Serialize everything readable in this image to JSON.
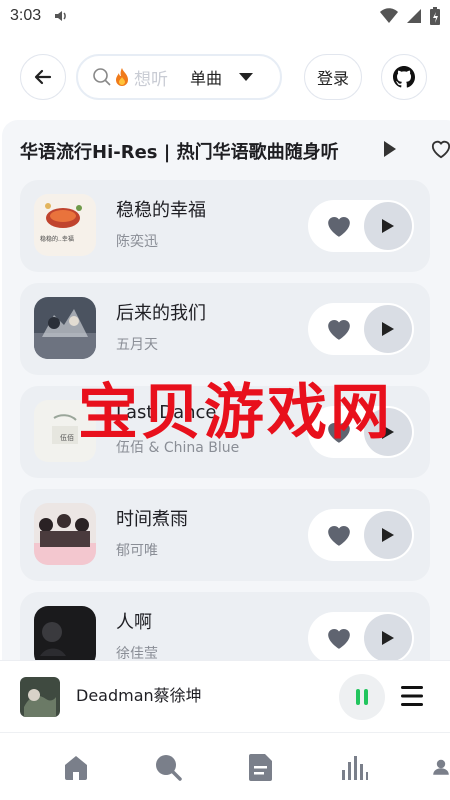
{
  "status_bar": {
    "time": "3:03"
  },
  "search": {
    "placeholder": "想听",
    "selected_type": "单曲"
  },
  "header": {
    "login_label": "登录"
  },
  "playlist": {
    "title": "华语流行Hi-Res | 热门华语歌曲随身听",
    "songs": [
      {
        "title": "稳稳的幸福",
        "artist": "陈奕迅",
        "cover_text": "稳稳的..幸福"
      },
      {
        "title": "后来的我们",
        "artist": "五月天"
      },
      {
        "title": "Last Dance",
        "artist": "伍佰 & China Blue",
        "cover_text": "伍佰"
      },
      {
        "title": "时间煮雨",
        "artist": "郁可唯"
      },
      {
        "title": "人啊",
        "artist": "徐佳莹"
      }
    ]
  },
  "watermark": "宝贝游戏网",
  "now_playing": {
    "title": "Deadman蔡徐坤"
  },
  "colors": {
    "accent_green": "#22c55e",
    "watermark_red": "#e8101c",
    "icon_gray": "#5f6470"
  },
  "tabs": [
    "home-icon",
    "search-icon",
    "document-icon",
    "chart-icon",
    "user-icon"
  ]
}
